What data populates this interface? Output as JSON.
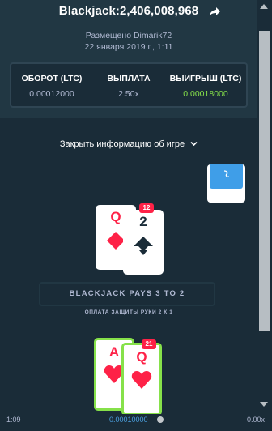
{
  "header": {
    "title": "Blackjack:2,406,008,968",
    "placed_by": "Размещено Dimarik72",
    "date": "22 января 2019 г., 1:11"
  },
  "stats": {
    "turnover_label": "ОБОРОТ (LTC)",
    "turnover_value": "0.00012000",
    "payout_label": "ВЫПЛАТА",
    "payout_value": "2.50x",
    "win_label": "ВЫИГРЫШ (LTC)",
    "win_value": "0.00018000"
  },
  "toggle_label": "Закрыть информацию об игре",
  "dealer": {
    "total": "12",
    "cards": [
      {
        "rank": "Q",
        "suit": "diamond",
        "color": "#fe2247"
      },
      {
        "rank": "2",
        "suit": "spade",
        "color": "#1a2c38"
      }
    ]
  },
  "banner": "BLACKJACK PAYS 3 TO 2",
  "insurance": "ОПЛАТА ЗАЩИТЫ РУКИ 2 К 1",
  "player": {
    "total": "21",
    "cards": [
      {
        "rank": "A",
        "suit": "heart",
        "color": "#fe2247"
      },
      {
        "rank": "Q",
        "suit": "heart",
        "color": "#fe2247"
      }
    ]
  },
  "footer": {
    "time": "1:09",
    "amount": "0.00010000",
    "multiplier": "0.00x"
  },
  "colors": {
    "background": "#1a2c38",
    "panel": "#213743",
    "win_green": "#86e14a",
    "card_red": "#fe2247"
  }
}
